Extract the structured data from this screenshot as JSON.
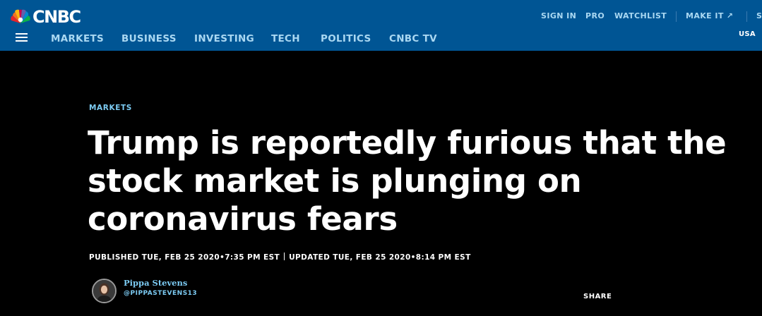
{
  "brand": {
    "name": "CNBC",
    "accent": "#005594"
  },
  "top_links": {
    "sign_in": "SIGN IN",
    "pro": "PRO",
    "watchlist": "WATCHLIST",
    "make_it": "MAKE IT",
    "overflow": "S"
  },
  "region": "USA",
  "nav": {
    "items": [
      "MARKETS",
      "BUSINESS",
      "INVESTING",
      "TECH",
      "POLITICS",
      "CNBC TV"
    ]
  },
  "article": {
    "section": "MARKETS",
    "headline_lines": [
      "Trump is reportedly furious that the",
      "stock market is plunging on",
      "coronavirus fears"
    ],
    "published": "PUBLISHED TUE, FEB 25 2020•7:35 PM EST",
    "updated": "UPDATED TUE, FEB 25 2020•8:14 PM EST",
    "author_name": "Pippa Stevens",
    "author_handle": "@PIPPASTEVENS13",
    "share_label": "SHARE"
  },
  "icons": {
    "menu": "hamburger-icon",
    "external": "external-link-icon",
    "logo": "peacock-icon"
  }
}
